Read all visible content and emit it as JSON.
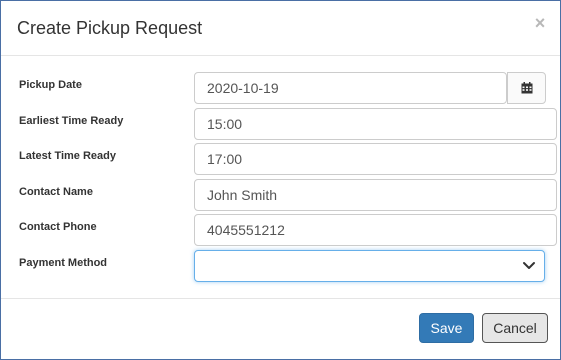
{
  "modal": {
    "title": "Create Pickup Request",
    "close_symbol": "×"
  },
  "form": {
    "pickup_date": {
      "label": "Pickup Date",
      "value": "2020-10-19",
      "button_icon": "calendar-icon"
    },
    "earliest_time": {
      "label": "Earliest Time Ready",
      "value": "15:00"
    },
    "latest_time": {
      "label": "Latest Time Ready",
      "value": "17:00"
    },
    "contact_name": {
      "label": "Contact Name",
      "value": "John Smith"
    },
    "contact_phone": {
      "label": "Contact Phone",
      "value": "4045551212"
    },
    "payment_method": {
      "label": "Payment Method",
      "value": "",
      "dropdown_icon": "chevron-down-icon"
    }
  },
  "footer": {
    "save_label": "Save",
    "cancel_label": "Cancel"
  },
  "colors": {
    "primary": "#337ab7",
    "focus_border": "#66afe9",
    "modal_border": "#4a6fa5"
  }
}
